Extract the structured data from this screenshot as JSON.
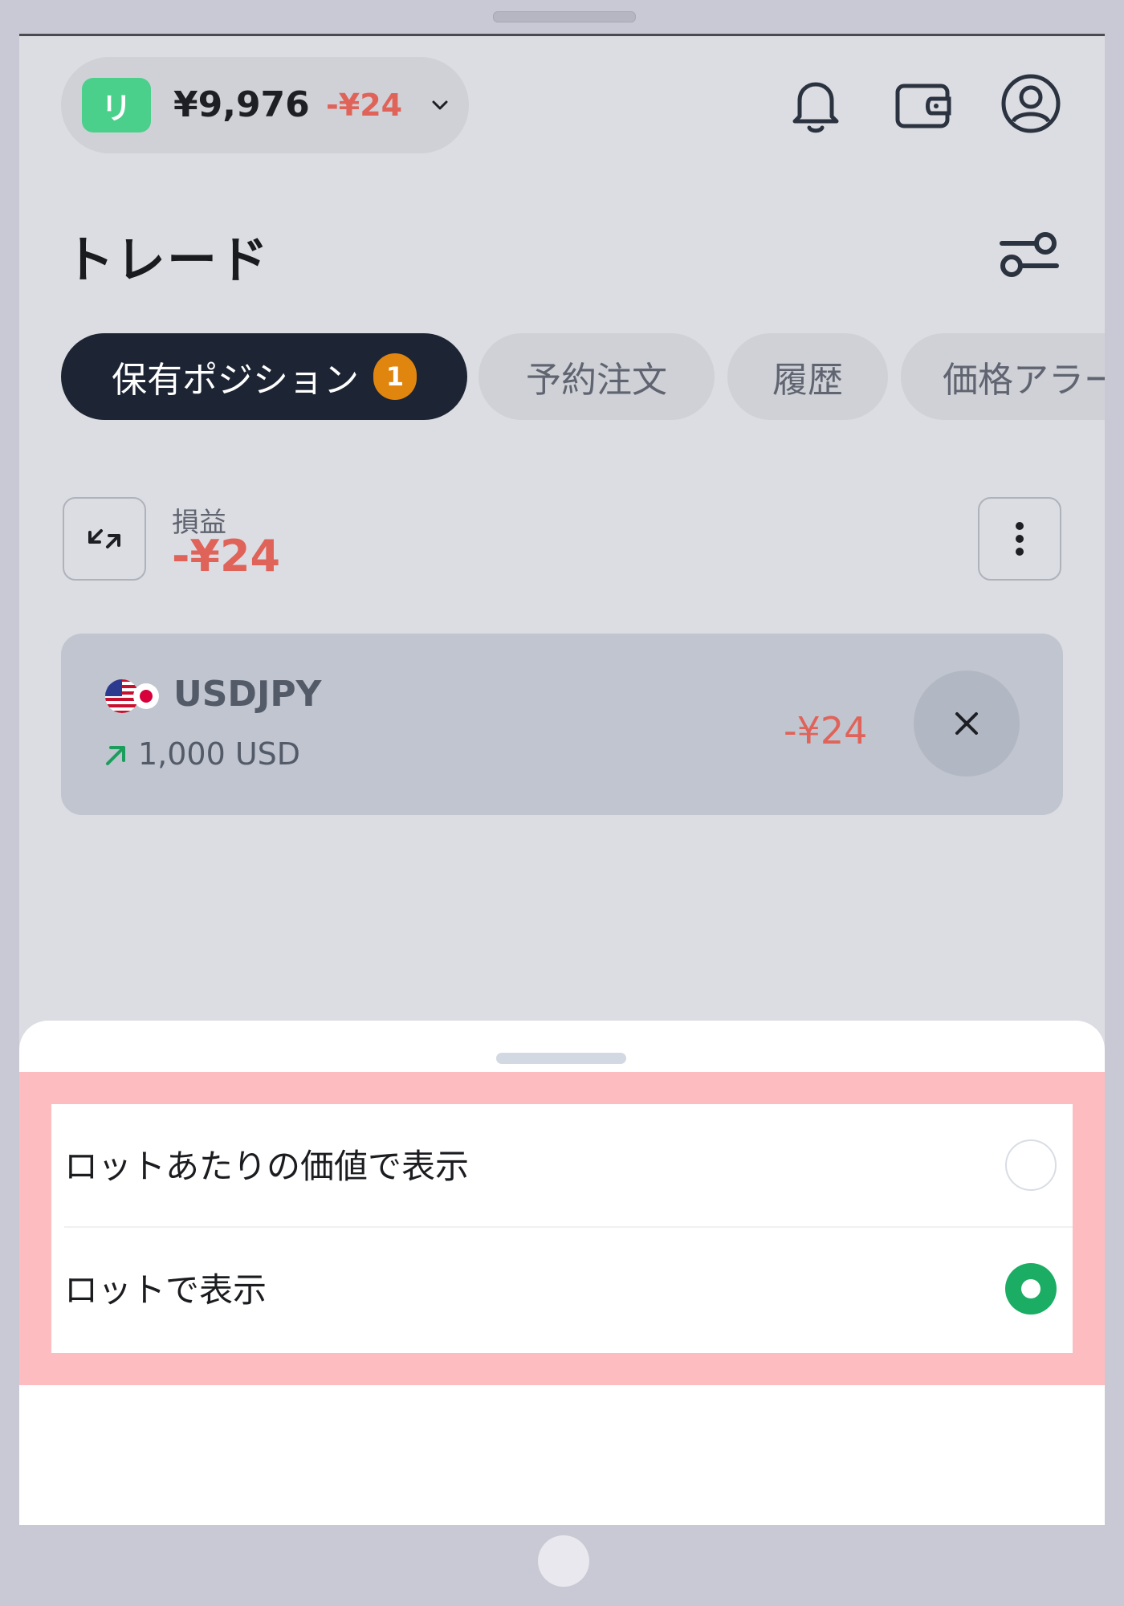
{
  "header": {
    "account_badge": "リ",
    "balance": "¥9,976",
    "balance_change": "-¥24",
    "icons": [
      "bell-icon",
      "wallet-icon",
      "user-icon"
    ]
  },
  "page": {
    "title": "トレード",
    "filter_icon": "sliders-icon"
  },
  "tabs": [
    {
      "label": "保有ポジション",
      "count": "1",
      "active": true
    },
    {
      "label": "予約注文",
      "active": false
    },
    {
      "label": "履歴",
      "active": false
    },
    {
      "label": "価格アラート",
      "active": false
    }
  ],
  "summary": {
    "pl_label": "損益",
    "pl_value": "-¥24"
  },
  "position": {
    "symbol": "USDJPY",
    "direction": "buy",
    "size": "1,000 USD",
    "pl": "-¥24"
  },
  "sheet": {
    "options": [
      {
        "label": "ロットあたりの価値で表示",
        "selected": false
      },
      {
        "label": "ロットで表示",
        "selected": true
      }
    ]
  },
  "colors": {
    "accent_green": "#1aad63",
    "loss_red": "#e0635a",
    "badge_orange": "#e0860f",
    "tab_active": "#1d2433",
    "highlight": "#fdbcbf"
  }
}
